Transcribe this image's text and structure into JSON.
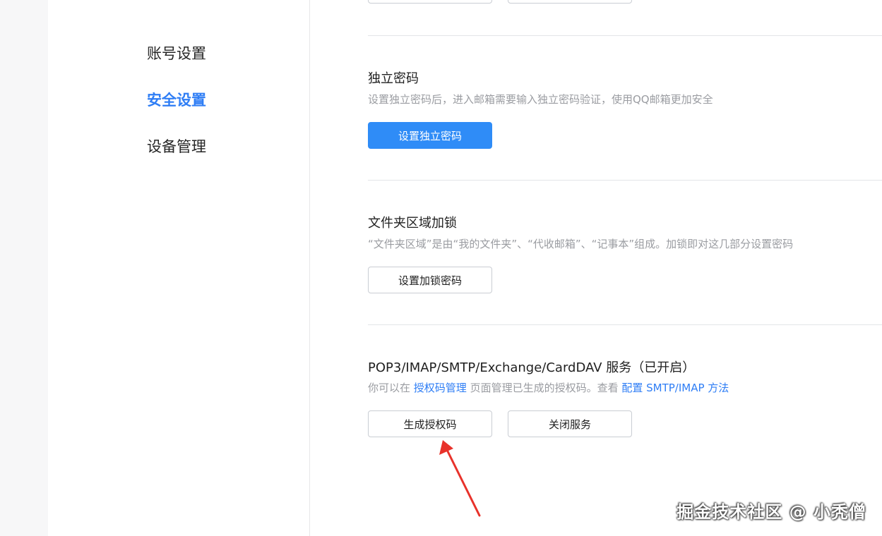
{
  "sidebar": {
    "items": [
      {
        "label": "账号设置",
        "active": false
      },
      {
        "label": "安全设置",
        "active": true
      },
      {
        "label": "设备管理",
        "active": false
      }
    ]
  },
  "sections": {
    "independent_password": {
      "title": "独立密码",
      "description": "设置独立密码后，进入邮箱需要输入独立密码验证，使用QQ邮箱更加安全",
      "button": "设置独立密码"
    },
    "folder_lock": {
      "title": "文件夹区域加锁",
      "description": "“文件夹区域”是由“我的文件夹”、“代收邮箱”、“记事本”组成。加锁即对这几部分设置密码",
      "button": "设置加锁密码"
    },
    "mail_service": {
      "title": "POP3/IMAP/SMTP/Exchange/CardDAV 服务（已开启）",
      "desc_prefix": "你可以在 ",
      "desc_link1": "授权码管理",
      "desc_middle": " 页面管理已生成的授权码。查看 ",
      "desc_link2": "配置 SMTP/IMAP 方法",
      "generate_button": "生成授权码",
      "close_button": "关闭服务"
    }
  },
  "annotation": {
    "arrow_color": "#e8322b"
  },
  "watermark": "掘金技术社区 @ 小秃僧"
}
